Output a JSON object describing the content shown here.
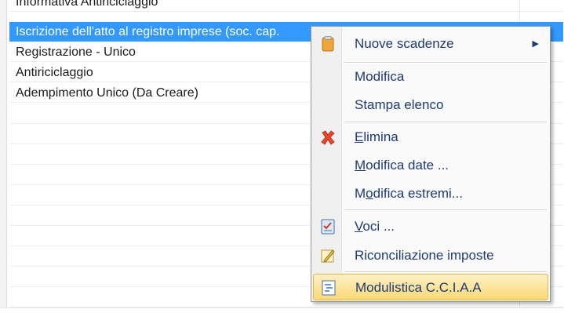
{
  "list": {
    "rows": [
      "Informativa Antiriciclaggio",
      "Iscrizione dell'atto al registro imprese (soc. cap.",
      "Registrazione - Unico",
      "Antiriciclaggio",
      "Adempimento Unico (Da Creare)"
    ]
  },
  "context_menu": {
    "items": {
      "nuove_scadenze": {
        "label": "Nuove scadenze",
        "icon": "clipboard-icon",
        "has_submenu": true
      },
      "modifica": {
        "label": "Modifica"
      },
      "stampa_elenco": {
        "label": "Stampa elenco"
      },
      "elimina": {
        "label_pre": "",
        "label_u": "E",
        "label_post": "limina",
        "icon": "red-x-icon"
      },
      "modifica_date": {
        "label_u": "M",
        "label_post": "odifica date ..."
      },
      "modifica_estremi": {
        "label_pre": "M",
        "label_u": "o",
        "label_post": "difica estremi..."
      },
      "voci": {
        "label_u": "V",
        "label_post": "oci ...",
        "icon": "checklist-icon"
      },
      "riconciliazione": {
        "label": "Riconciliazione imposte",
        "icon": "edit-note-icon"
      },
      "modulistica": {
        "label": "Modulistica C.C.I.A.A",
        "icon": "form-icon",
        "hovered": true
      }
    }
  },
  "colors": {
    "selection": "#3399ff",
    "menu_text": "#1f3a73",
    "hover_gradient": [
      "#fdf0c4",
      "#fbd977"
    ],
    "delete_icon": "#e8492c"
  }
}
